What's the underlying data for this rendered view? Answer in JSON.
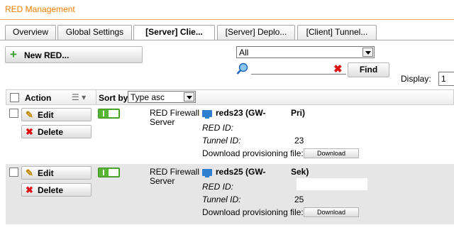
{
  "app": {
    "title": "RED Management"
  },
  "tabs": [
    {
      "label": "Overview",
      "active": false
    },
    {
      "label": "Global Settings",
      "active": false
    },
    {
      "label": "[Server] Clie...",
      "active": true
    },
    {
      "label": "[Server] Deplo...",
      "active": false
    },
    {
      "label": "[Client] Tunnel...",
      "active": false
    }
  ],
  "toolbar": {
    "new_label": "New RED...",
    "filter_value": "All",
    "search_value": "",
    "find_label": "Find",
    "display_label": "Display:",
    "display_value": "1"
  },
  "table": {
    "header": {
      "action": "Action",
      "sort_by": "Sort by:",
      "sort_value": "Type asc"
    },
    "edit_label": "Edit",
    "delete_label": "Delete",
    "rows": [
      {
        "type": "RED Firewall Server",
        "name_prefix": "reds23 (GW-",
        "name_suffix": "Pri)",
        "red_id_label": "RED ID:",
        "tunnel_id_label": "Tunnel ID:",
        "tunnel_id": "23",
        "download_label": "Download provisioning file:",
        "download_button": "Download"
      },
      {
        "type": "RED Firewall Server",
        "name_prefix": "reds25 (GW-",
        "name_suffix": "Sek)",
        "red_id_label": "RED ID:",
        "tunnel_id_label": "Tunnel ID:",
        "tunnel_id": "25",
        "download_label": "Download provisioning file:",
        "download_button": "Download"
      }
    ]
  },
  "colors": {
    "title": "#f07d00",
    "toggle_on": "#56b534",
    "server_icon": "#2f7fd1",
    "delete_icon": "#dd1111"
  },
  "icons": {
    "new": "plus-icon",
    "search": "magnifier-icon",
    "clear": "clear-x-icon",
    "edit": "edit-icon",
    "delete": "delete-x-icon",
    "server": "server-icon"
  }
}
